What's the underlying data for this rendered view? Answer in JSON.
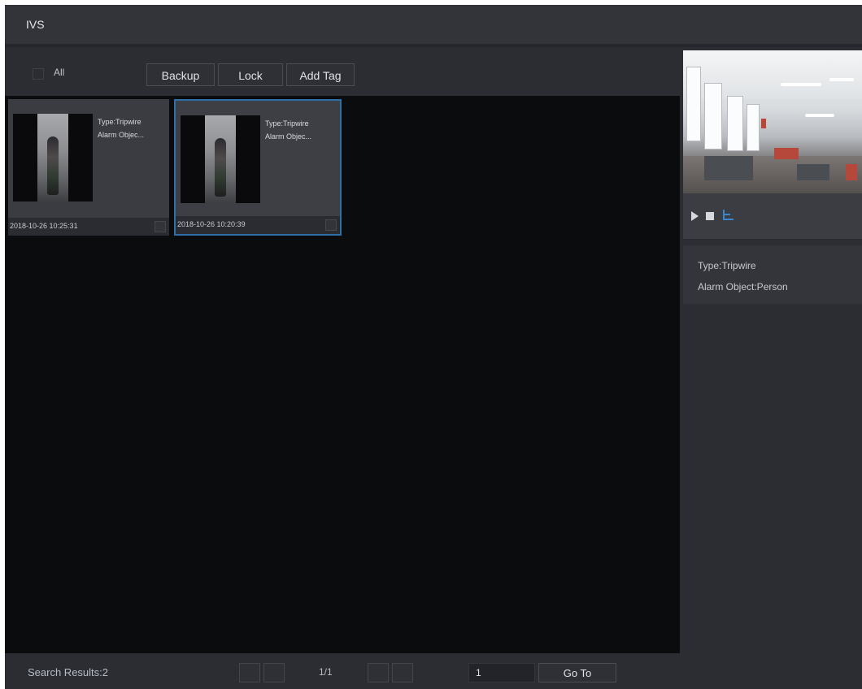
{
  "window": {
    "title": "IVS"
  },
  "toolbar": {
    "select_all_label": "All",
    "backup_label": "Backup",
    "lock_label": "Lock",
    "add_tag_label": "Add Tag"
  },
  "results": [
    {
      "type_text": "Type:Tripwire",
      "alarm_text": "Alarm Objec...",
      "timestamp": "2018-10-26 10:25:31"
    },
    {
      "type_text": "Type:Tripwire",
      "alarm_text": "Alarm Objec...",
      "timestamp": "2018-10-26 10:20:39"
    }
  ],
  "detail": {
    "type_text": "Type:Tripwire",
    "alarm_object_text": "Alarm Object:Person"
  },
  "status": {
    "search_results": "Search Results:2",
    "page_indicator": "1/1",
    "page_input_value": "1",
    "go_to_label": "Go To"
  },
  "colors": {
    "background": "#25272d",
    "selected_border": "#2f6fa8",
    "grid_background": "#0b0c0e"
  }
}
